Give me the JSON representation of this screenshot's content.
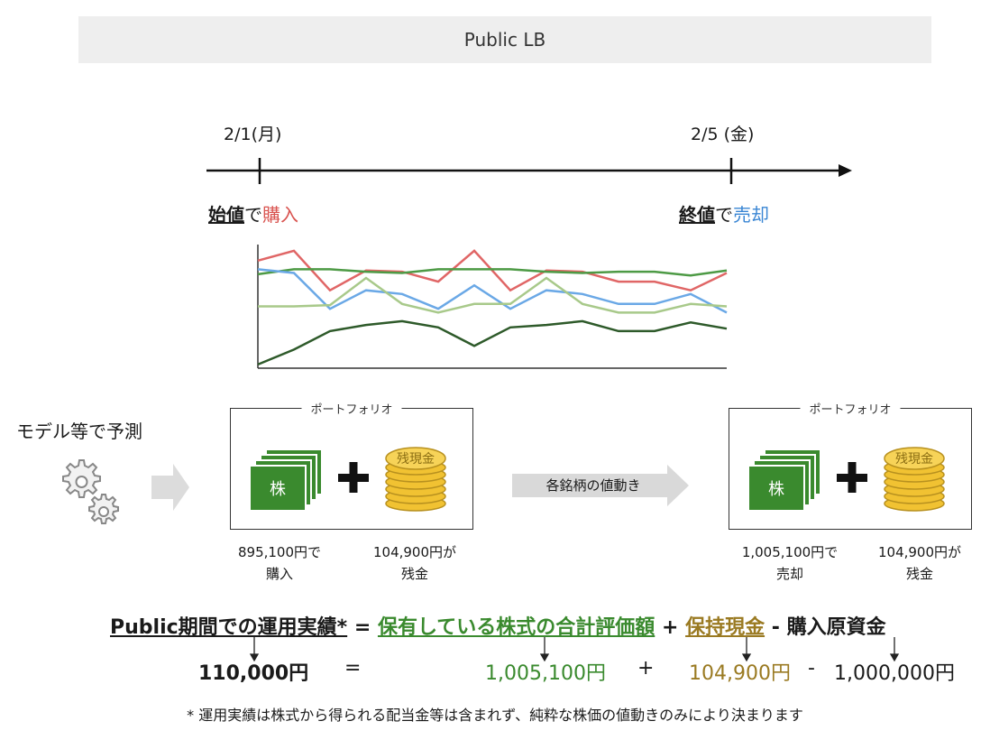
{
  "header": {
    "title": "Public LB"
  },
  "timeline": {
    "start_date": "2/1(月)",
    "end_date": "2/5 (金)",
    "start_action": {
      "price": "始値",
      "de": "で",
      "verb": "購入"
    },
    "end_action": {
      "price": "終値",
      "de": "で",
      "verb": "売却"
    }
  },
  "model_label": "モデル等で予測",
  "portfolio_label": "ポートフォリオ",
  "stock_label": "株",
  "cash_label": "残現金",
  "movement_label": "各銘柄の値動き",
  "left_captions": {
    "stock_line1": "895,100円で",
    "stock_line2": "購入",
    "cash_line1": "104,900円が",
    "cash_line2": "残金"
  },
  "right_captions": {
    "stock_line1": "1,005,100円で",
    "stock_line2": "売却",
    "cash_line1": "104,900円が",
    "cash_line2": "残金"
  },
  "formula": {
    "lhs": "Public期間での運用実績*",
    "eq": "=",
    "term1": "保有している株式の合計評価額",
    "plus": "+",
    "term2": "保持現金",
    "minus": "-",
    "term3": "購入原資金"
  },
  "numbers": {
    "result": "110,000円",
    "eq": "=",
    "stock_value": "1,005,100円",
    "plus": "+",
    "cash": "104,900円",
    "minus": "-",
    "principal": "1,000,000円"
  },
  "footnote": "* 運用実績は株式から得られる配当金等は含まれず、純粋な株価の値動きのみにより決まります",
  "colors": {
    "buy": "#d9534f",
    "sell": "#3a86d4",
    "stock_green": "#3a8a2e",
    "cash_gold": "#9a7a22"
  },
  "chart_data": {
    "type": "line",
    "x": [
      1,
      2,
      3,
      4,
      5,
      6,
      7,
      8,
      9,
      10,
      11,
      12,
      13,
      14
    ],
    "series": [
      {
        "color": "#e06666",
        "values": [
          87,
          95,
          63,
          79,
          78,
          70,
          95,
          63,
          79,
          78,
          70,
          70,
          63,
          77
        ]
      },
      {
        "color": "#4d9a45",
        "values": [
          76,
          80,
          80,
          78,
          77,
          80,
          80,
          80,
          78,
          77,
          78,
          78,
          75,
          79
        ]
      },
      {
        "color": "#6aa8e6",
        "values": [
          80,
          77,
          48,
          63,
          60,
          48,
          67,
          48,
          63,
          60,
          52,
          52,
          60,
          45
        ]
      },
      {
        "color": "#a8c98a",
        "values": [
          50,
          50,
          51,
          73,
          52,
          45,
          52,
          52,
          73,
          52,
          45,
          45,
          52,
          50
        ]
      },
      {
        "color": "#2e5a2a",
        "values": [
          3,
          15,
          30,
          35,
          38,
          33,
          18,
          33,
          35,
          38,
          30,
          30,
          37,
          32
        ]
      }
    ],
    "ylim": [
      0,
      100
    ],
    "grid": false
  }
}
